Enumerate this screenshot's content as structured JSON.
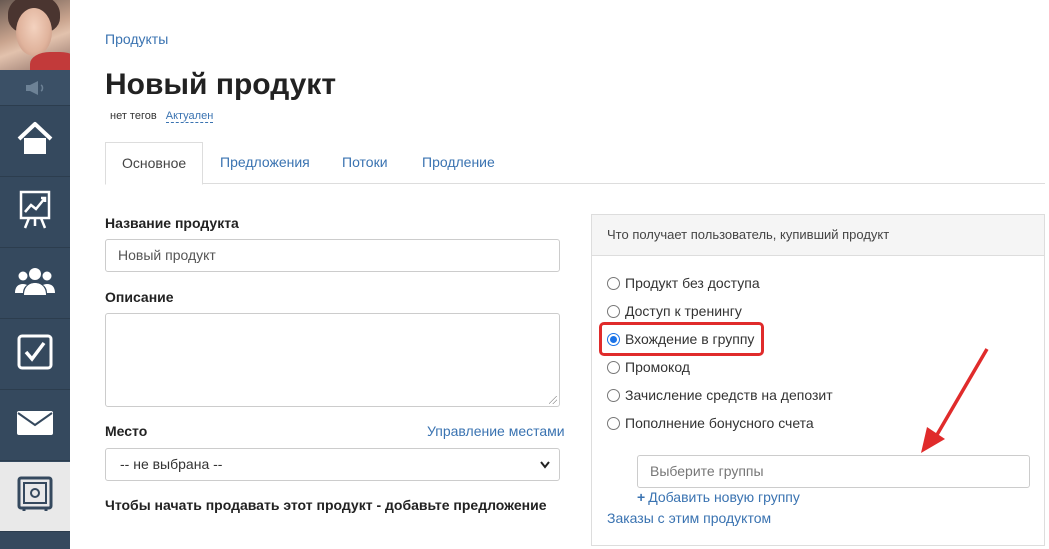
{
  "sidebar": {
    "items": [
      {
        "name": "home",
        "icon": "home-icon"
      },
      {
        "name": "stats",
        "icon": "chart-easel-icon"
      },
      {
        "name": "users",
        "icon": "users-icon"
      },
      {
        "name": "tasks",
        "icon": "checkbox-icon"
      },
      {
        "name": "mail",
        "icon": "envelope-icon"
      },
      {
        "name": "safe",
        "icon": "safe-icon",
        "active": true
      }
    ]
  },
  "breadcrumb": "Продукты",
  "title": "Новый продукт",
  "tags": {
    "no_tags": "нет тегов",
    "status": "Актуален"
  },
  "tabs": [
    {
      "label": "Основное",
      "active": true
    },
    {
      "label": "Предложения"
    },
    {
      "label": "Потоки"
    },
    {
      "label": "Продление"
    }
  ],
  "form": {
    "name_label": "Название продукта",
    "name_value": "Новый продукт",
    "description_label": "Описание",
    "place_label": "Место",
    "manage_places": "Управление местами",
    "place_value": "-- не выбрана --",
    "cta": "Чтобы начать продавать этот продукт - добавьте предложение"
  },
  "panel": {
    "title": "Что получает пользователь, купивший продукт",
    "options": [
      {
        "label": "Продукт без доступа",
        "checked": false
      },
      {
        "label": "Доступ к тренингу",
        "checked": false
      },
      {
        "label": "Вхождение в группу",
        "checked": true
      },
      {
        "label": "Промокод",
        "checked": false
      },
      {
        "label": "Зачисление средств на депозит",
        "checked": false
      },
      {
        "label": "Пополнение бонусного счета",
        "checked": false
      }
    ],
    "group_placeholder": "Выберите группы",
    "add_group": "Добавить новую группу",
    "orders_link": "Заказы с этим продуктом"
  },
  "colors": {
    "sidebar": "#35495e",
    "link": "#3a73b1",
    "highlight": "#e02b2b"
  }
}
